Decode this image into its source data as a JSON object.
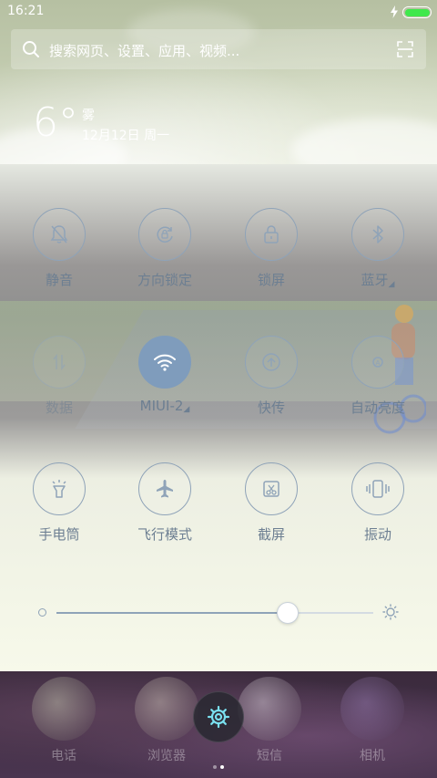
{
  "status_bar": {
    "time": "16:21",
    "battery_level": 1.0,
    "battery_color": "#3fe84c",
    "charging": true
  },
  "search": {
    "placeholder": "搜索网页、设置、应用、视频...",
    "icon": "search-icon",
    "scan_icon": "scan-icon"
  },
  "weather": {
    "temperature": "6°",
    "condition": "雾",
    "date": "12月12日 周一"
  },
  "toggles": [
    {
      "label": "静音",
      "icon": "bell-off-icon",
      "state": "off"
    },
    {
      "label": "方向锁定",
      "icon": "rotation-lock-icon",
      "state": "off"
    },
    {
      "label": "锁屏",
      "icon": "lock-icon",
      "state": "off"
    },
    {
      "label": "蓝牙",
      "icon": "bluetooth-icon",
      "state": "off",
      "has_submenu": true
    },
    {
      "label": "数据",
      "icon": "mobile-data-icon",
      "state": "disabled"
    },
    {
      "label": "MIUI-2",
      "icon": "wifi-icon",
      "state": "on",
      "has_submenu": true
    },
    {
      "label": "快传",
      "icon": "quick-transfer-icon",
      "state": "off"
    },
    {
      "label": "自动亮度",
      "icon": "auto-brightness-icon",
      "state": "off"
    },
    {
      "label": "手电筒",
      "icon": "flashlight-icon",
      "state": "off"
    },
    {
      "label": "飞行模式",
      "icon": "airplane-icon",
      "state": "off"
    },
    {
      "label": "截屏",
      "icon": "screenshot-icon",
      "state": "off"
    },
    {
      "label": "振动",
      "icon": "vibrate-icon",
      "state": "off"
    }
  ],
  "brightness": {
    "level": 0.73,
    "min_icon": "brightness-low-icon",
    "max_icon": "brightness-high-icon"
  },
  "dock": {
    "apps": [
      {
        "label": "电话",
        "icon": "phone-app-icon",
        "color": "#cfd4b8"
      },
      {
        "label": "浏览器",
        "icon": "browser-app-icon",
        "color": "#d8d0c0"
      },
      {
        "label": "短信",
        "icon": "messages-app-icon",
        "color": "#e6dfe6"
      },
      {
        "label": "相机",
        "icon": "camera-app-icon",
        "color": "#9a7fb6"
      }
    ],
    "settings_icon": "settings-gear-icon",
    "settings_color": "#7ae0f0",
    "pages": 2,
    "current_page": 2
  },
  "colors": {
    "accent": "#7f9cbc",
    "label": "#6d7f92"
  }
}
